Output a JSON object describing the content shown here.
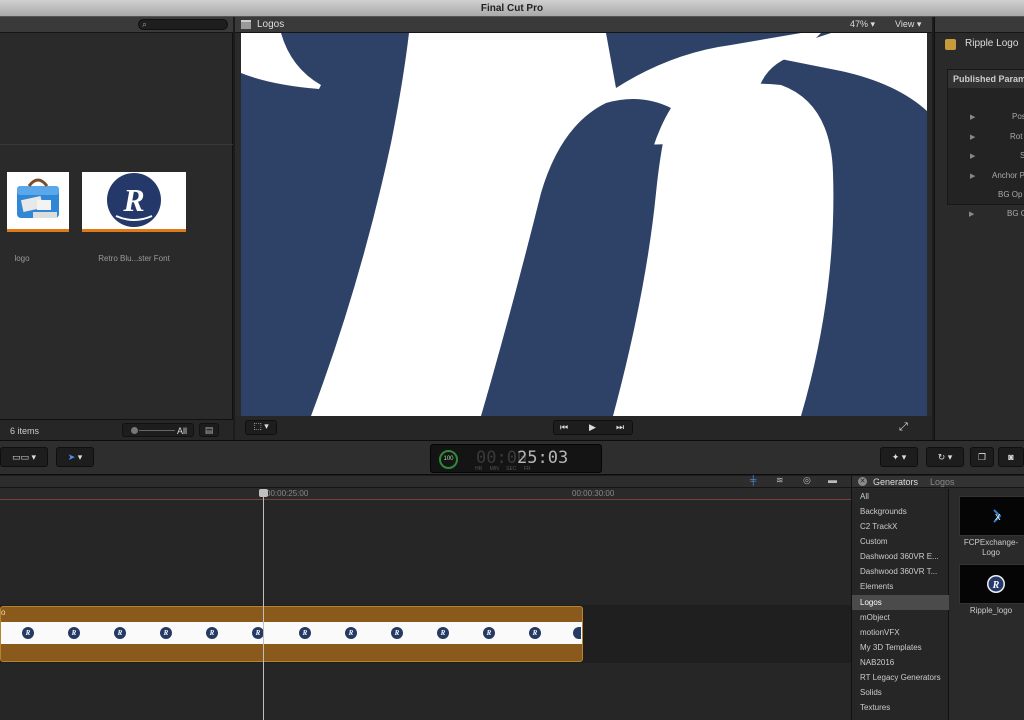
{
  "window": {
    "title": "Final Cut Pro"
  },
  "browser": {
    "items_count": "6 items",
    "zoom_all": "All",
    "clips": [
      {
        "label": "logo",
        "icon": "toolbox-icon"
      },
      {
        "label": "Retro Blu...ster Font",
        "icon": "r-logo-icon"
      }
    ]
  },
  "viewer": {
    "title": "Logos",
    "zoom": "47%",
    "view_label": "View"
  },
  "inspector": {
    "title": "Ripple Logo",
    "section": "Published Param",
    "params": [
      {
        "label": "Pos",
        "expandable": true
      },
      {
        "label": "Rot",
        "expandable": true
      },
      {
        "label": "S",
        "expandable": true
      },
      {
        "label": "Anchor P",
        "expandable": true
      },
      {
        "label": "BG Op",
        "expandable": false
      },
      {
        "label": "BG C",
        "expandable": true
      }
    ]
  },
  "toolbar": {
    "timecode_badge": "100",
    "timecode_dim": "00:00:",
    "timecode_value": "25:03",
    "timecode_units": "HR MIN SEC FR"
  },
  "timeline": {
    "ruler": [
      "00:00:25:00",
      "00:00:30:00"
    ],
    "clip_label": "o",
    "badge_glyph": "R"
  },
  "generators": {
    "title": "Generators",
    "crumb": "Logos",
    "categories": [
      "All",
      "Backgrounds",
      "C2 TrackX",
      "Custom",
      "Dashwood 360VR E...",
      "Dashwood 360VR T...",
      "Elements",
      "Logos",
      "mObject",
      "motionVFX",
      "My 3D Templates",
      "NAB2016",
      "RT Legacy Generators",
      "Solids",
      "Textures"
    ],
    "selected": "Logos",
    "items": [
      {
        "label": "FCPExchange-Logo",
        "line1": "FCPExchange-",
        "line2": "Logo"
      },
      {
        "label": "Ripple_logo",
        "line1": "Ripple_logo",
        "line2": ""
      }
    ]
  },
  "colors": {
    "accent_orange": "#e07a16",
    "canvas_blue": "#2e4268",
    "clip_brown": "#8a5a1c"
  }
}
